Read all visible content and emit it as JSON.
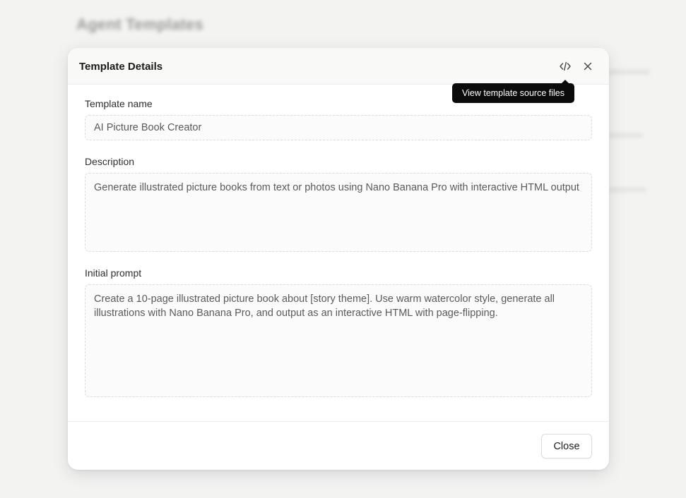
{
  "background": {
    "page_title": "Agent Templates"
  },
  "modal": {
    "title": "Template Details",
    "source_icon": "code-brackets-icon",
    "close_icon": "close-icon",
    "tooltip": "View template source files",
    "fields": {
      "name": {
        "label": "Template name",
        "value": "AI Picture Book Creator"
      },
      "description": {
        "label": "Description",
        "value": "Generate illustrated picture books from text or photos using Nano Banana Pro with interactive HTML output"
      },
      "prompt": {
        "label": "Initial prompt",
        "value": "Create a 10-page illustrated picture book about [story theme]. Use warm watercolor style, generate all illustrations with Nano Banana Pro, and output as an interactive HTML with page-flipping."
      }
    },
    "footer": {
      "close_label": "Close"
    }
  },
  "colors": {
    "backdrop": "#f3f3f2",
    "modal_bg": "#ffffff",
    "header_bg": "#f9f9f8",
    "tooltip_bg": "#0b0b0b",
    "text_primary": "#1b1b1b",
    "text_secondary": "#5a5a5a"
  }
}
